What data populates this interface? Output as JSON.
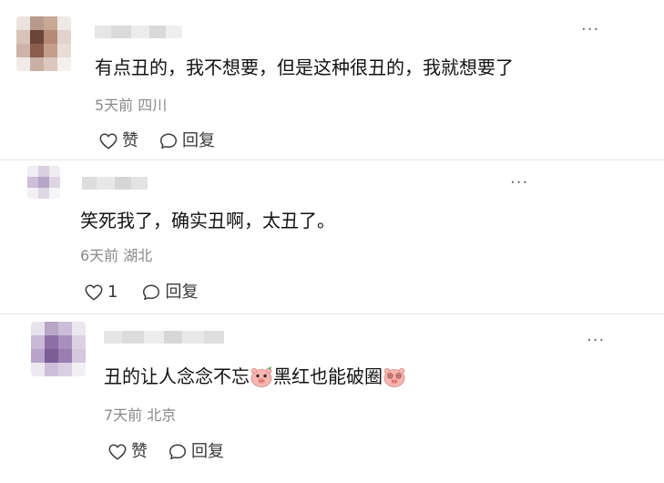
{
  "comments": [
    {
      "text": "有点丑的，我不想要，但是这种很丑的，我就想要了",
      "meta": "5天前 四川",
      "like_label": "赞",
      "reply_label": "回复",
      "more_label": "···"
    },
    {
      "text": "笑死我了，确实丑啊，太丑了。",
      "meta": "6天前 湖北",
      "like_label": "1",
      "reply_label": "回复",
      "more_label": "···"
    },
    {
      "text_part1": "丑的让人念念不忘",
      "text_part2": "黑红也能破圈",
      "meta": "7天前 北京",
      "like_label": "赞",
      "reply_label": "回复",
      "more_label": "···"
    }
  ],
  "icons": {
    "like": "heart-outline-icon",
    "reply": "speech-bubble-icon",
    "more": "ellipsis-icon",
    "emoji": "pig-face-emoji"
  },
  "colors": {
    "text": "#121212",
    "meta": "#8a8a8a",
    "action": "#3a3a3a"
  }
}
